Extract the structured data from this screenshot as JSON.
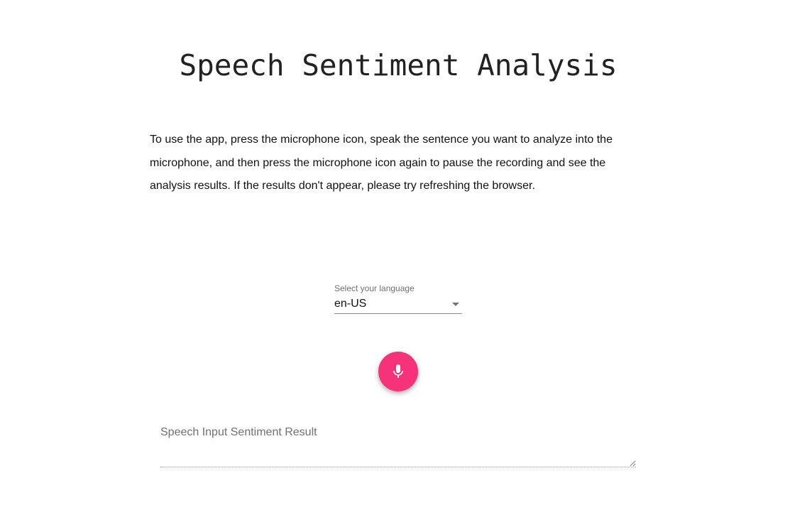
{
  "header": {
    "title": "Speech Sentiment Analysis"
  },
  "instructions": {
    "text": "To use the app, press the microphone icon, speak the sentence you want to analyze into the microphone, and then press the microphone icon again to pause the recording and see the analysis results. If the results don't appear, please try refreshing the browser."
  },
  "language": {
    "label": "Select your language",
    "selected": "en-US"
  },
  "mic": {
    "icon": "microphone-icon",
    "color": "#f6327a"
  },
  "result": {
    "placeholder": "Speech Input Sentiment Result",
    "value": ""
  }
}
